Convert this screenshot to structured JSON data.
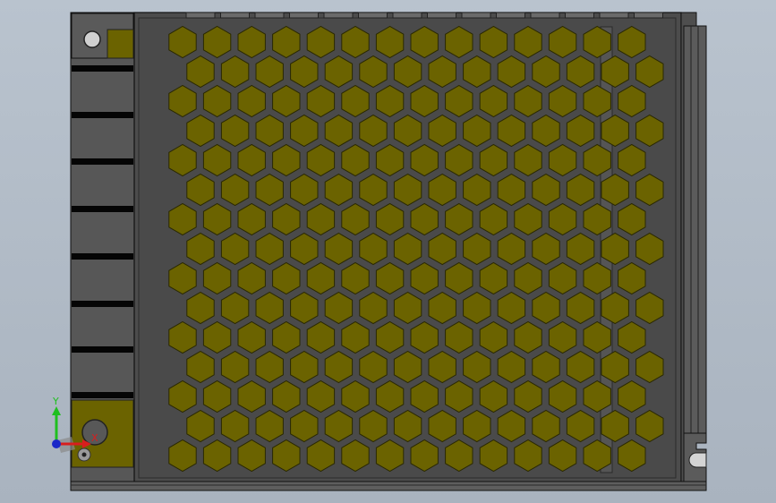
{
  "viewport": {
    "background": "#b2bcc7",
    "model": {
      "body_color": "#4a4a4a",
      "frame_color": "#5e5e5e",
      "edge_color": "#1a1a1a",
      "vent_color": "#6b6300",
      "vent_outline": "#2a2800",
      "mount_plate_color": "#6b6300",
      "slot_color": "#050505"
    }
  },
  "triad": {
    "y_label": "Y",
    "x_label": "X",
    "y_axis_color": "#1fbf1f",
    "x_axis_color": "#d81e1e",
    "z_axis_color": "#1a28c8"
  }
}
